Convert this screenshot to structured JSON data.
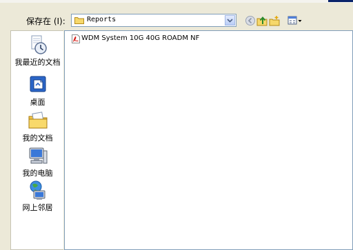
{
  "dialog": {
    "look_in_label": "保存在 (I):",
    "look_in_value": "Reports"
  },
  "toolbar": {
    "back_icon": "back-arrow-icon",
    "up_icon": "up-one-level-icon",
    "new_folder_icon": "create-new-folder-icon",
    "views_icon": "views-menu-icon"
  },
  "places": [
    {
      "label": "我最近的文档",
      "icon": "recent-documents-icon"
    },
    {
      "label": "桌面",
      "icon": "desktop-icon"
    },
    {
      "label": "我的文档",
      "icon": "my-documents-icon"
    },
    {
      "label": "我的电脑",
      "icon": "my-computer-icon"
    },
    {
      "label": "网上邻居",
      "icon": "network-places-icon"
    }
  ],
  "files": [
    {
      "name": "WDM System 10G 40G ROADM NF",
      "icon": "pdf-file-icon"
    }
  ],
  "colors": {
    "dialog_bg": "#ece9d8",
    "field_border": "#7f9db9",
    "title_blue": "#0a246a"
  }
}
